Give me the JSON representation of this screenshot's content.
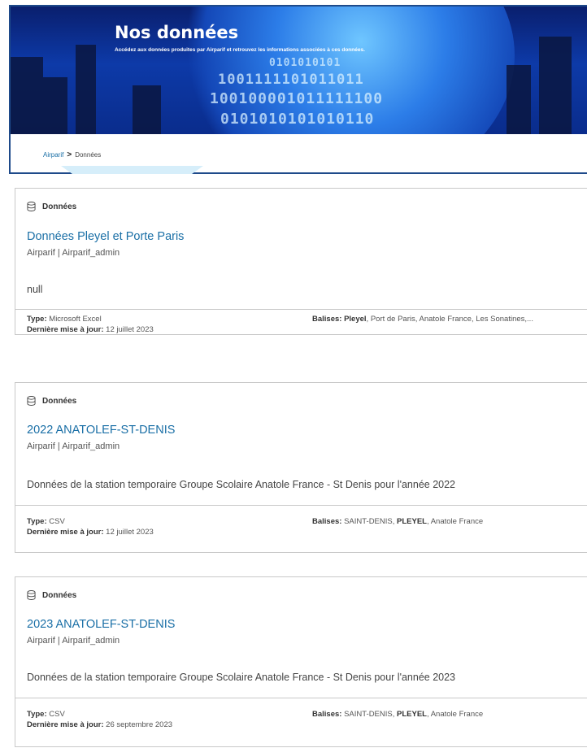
{
  "hero": {
    "title": "Nos données",
    "subtitle": "Accédez aux données produites par Airparif et retrouvez les informations associées à ces données.",
    "binary_lines": [
      "0101010101",
      "1001111101011011",
      "100100001011111100",
      "0101010101010110"
    ]
  },
  "breadcrumb": {
    "home": "Airparif",
    "separator": ">",
    "current": "Données"
  },
  "results": [
    {
      "type_label": "Données",
      "title": "Données Pleyel et Porte Paris",
      "owner": "Airparif | Airparif_admin",
      "description": "null",
      "type_key": "Type:",
      "type_value": "Microsoft Excel",
      "updated_key": "Dernière mise à jour:",
      "updated_value": "12 juillet 2023",
      "tags_key": "Balises:",
      "tags_bold": "Pleyel",
      "tags_rest": ", Port de Paris, Anatole France, Les Sonatines,..."
    },
    {
      "type_label": "Données",
      "title": "2022 ANATOLEF-ST-DENIS",
      "owner": "Airparif | Airparif_admin",
      "description": "Données de la station temporaire Groupe Scolaire Anatole France - St Denis pour l'année 2022",
      "type_key": "Type:",
      "type_value": "CSV",
      "updated_key": "Dernière mise à jour:",
      "updated_value": "12 juillet 2023",
      "tags_key": "Balises:",
      "tags_pre": " SAINT-DENIS, ",
      "tags_bold": "PLEYEL",
      "tags_rest": ", Anatole France"
    },
    {
      "type_label": "Données",
      "title": "2023 ANATOLEF-ST-DENIS",
      "owner": "Airparif | Airparif_admin",
      "description": "Données de la station temporaire Groupe Scolaire Anatole France - St Denis pour l'année 2023",
      "type_key": "Type:",
      "type_value": "CSV",
      "updated_key": "Dernière mise à jour:",
      "updated_value": "26 septembre 2023",
      "tags_key": "Balises:",
      "tags_pre": " SAINT-DENIS, ",
      "tags_bold": "PLEYEL",
      "tags_rest": ", Anatole France"
    }
  ],
  "colors": {
    "link": "#1a6fa6",
    "banner": "#0d3aa8",
    "frame": "#1e4a8a"
  },
  "icons": {
    "card_type": "database-icon",
    "breadcrumb_sep": "chevron-right-icon"
  }
}
